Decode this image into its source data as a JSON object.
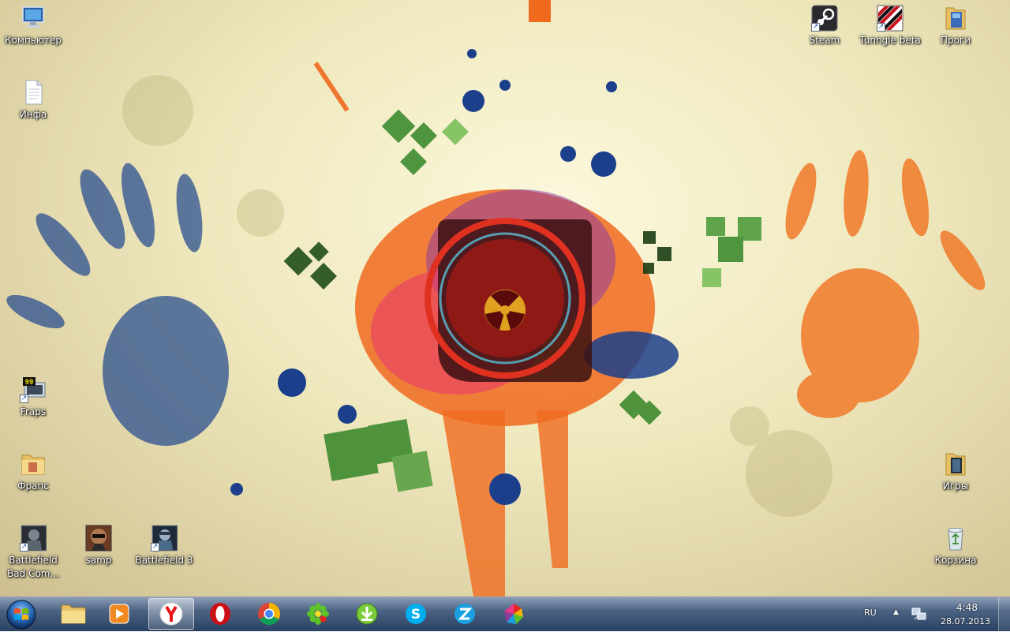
{
  "desktop": {
    "icons": [
      {
        "id": "computer",
        "label": "Компьютер"
      },
      {
        "id": "info",
        "label": "Инфа"
      },
      {
        "id": "fraps",
        "label": "Fraps"
      },
      {
        "id": "fraps-folder",
        "label": "Фрапс"
      },
      {
        "id": "battlefield-bc",
        "label": "Battlefield Bad Com..."
      },
      {
        "id": "samp",
        "label": "samp"
      },
      {
        "id": "battlefield-3",
        "label": "Battlefield 3"
      },
      {
        "id": "steam",
        "label": "Steam"
      },
      {
        "id": "tunngle",
        "label": "Tunngle beta"
      },
      {
        "id": "progi",
        "label": "Проги"
      },
      {
        "id": "games",
        "label": "Игры"
      },
      {
        "id": "recycle-bin",
        "label": "Корзина"
      }
    ],
    "fraps_badge": "99"
  },
  "taskbar": {
    "pinned": [
      {
        "id": "explorer",
        "icon": "folder-icon"
      },
      {
        "id": "media-player",
        "icon": "media-player-icon"
      },
      {
        "id": "yandex",
        "icon": "yandex-browser-icon",
        "active": true
      },
      {
        "id": "opera",
        "icon": "opera-icon"
      },
      {
        "id": "chrome",
        "icon": "chrome-icon"
      },
      {
        "id": "icq",
        "icon": "icq-icon"
      },
      {
        "id": "downloader",
        "icon": "download-icon"
      },
      {
        "id": "skype",
        "icon": "skype-icon"
      },
      {
        "id": "zona",
        "icon": "zona-icon"
      },
      {
        "id": "picasa",
        "icon": "picasa-icon"
      }
    ],
    "tray": {
      "language": "RU",
      "time": "4:48",
      "date": "28.07.2013"
    }
  },
  "colors": {
    "accent_orange": "#f06a1e",
    "accent_blue": "#1c3f8c",
    "accent_green": "#3d8a2e",
    "logo_red": "#a5201a"
  }
}
